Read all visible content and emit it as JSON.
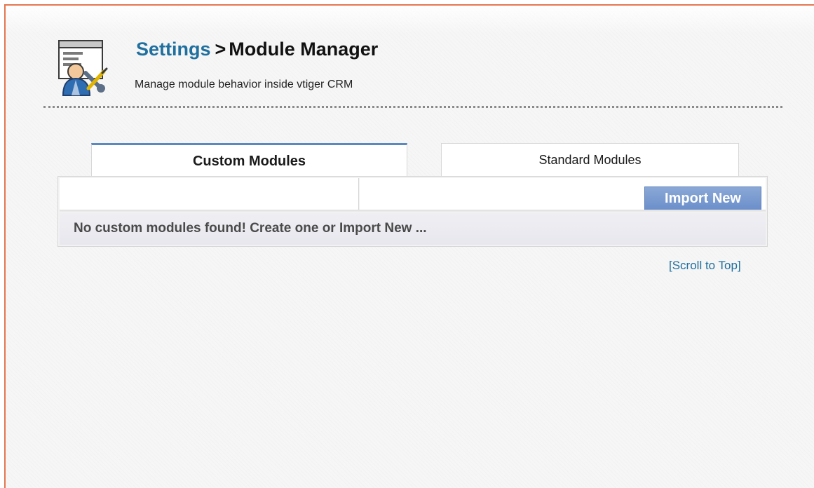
{
  "page": {
    "breadcrumb": {
      "root": "Settings",
      "separator": ">",
      "current": "Module Manager"
    },
    "subtitle": "Manage module behavior inside vtiger CRM"
  },
  "tabs": [
    {
      "label": "Custom Modules",
      "active": true
    },
    {
      "label": "Standard Modules",
      "active": false
    }
  ],
  "toolbar": {
    "import_label": "Import New"
  },
  "message": {
    "empty": "No custom modules found! Create one or Import New ..."
  },
  "links": {
    "scroll_top": "[Scroll to Top]"
  },
  "colors": {
    "accent_link": "#1f6f9f",
    "frame_border": "#e4774f",
    "button": "#6c8fcb",
    "active_tab_top": "#5b88c0"
  },
  "icons": {
    "header": "settings-tools-icon"
  }
}
